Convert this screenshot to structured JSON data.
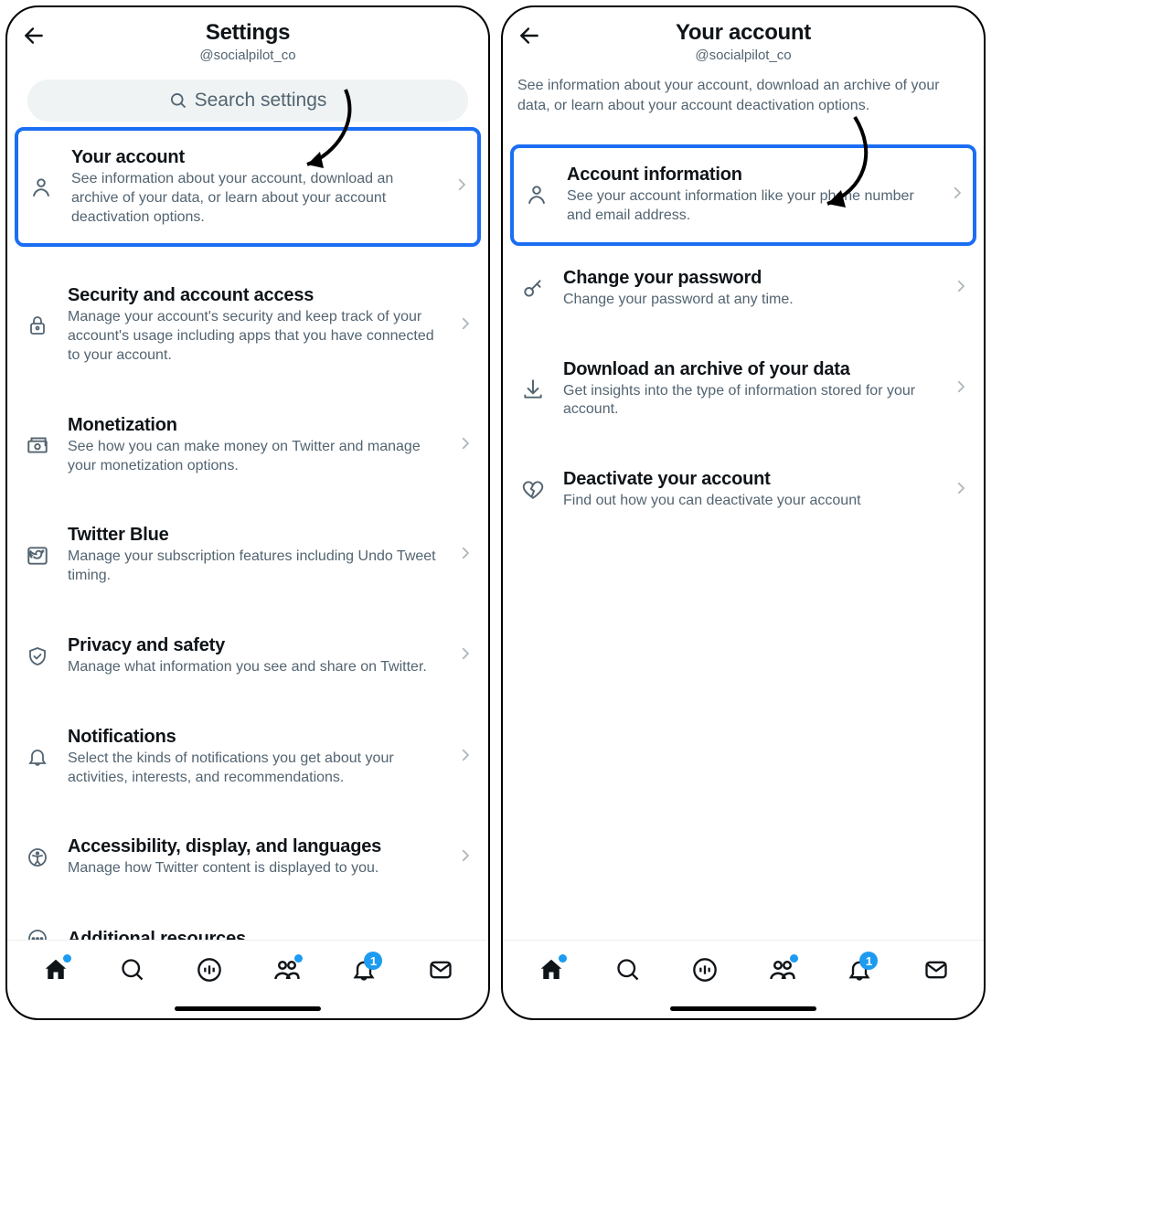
{
  "left": {
    "title": "Settings",
    "handle": "@socialpilot_co",
    "search_placeholder": "Search settings",
    "items": [
      {
        "label": "Your account",
        "desc": "See information about your account, download an archive of your data, or learn about your account deactivation options."
      },
      {
        "label": "Security and account access",
        "desc": "Manage your account's security and keep track of your account's usage including apps that you have connected to your account."
      },
      {
        "label": "Monetization",
        "desc": "See how you can make money on Twitter and manage your monetization options."
      },
      {
        "label": "Twitter Blue",
        "desc": "Manage your subscription features including Undo Tweet timing."
      },
      {
        "label": "Privacy and safety",
        "desc": "Manage what information you see and share on Twitter."
      },
      {
        "label": "Notifications",
        "desc": "Select the kinds of notifications you get about your activities, interests, and recommendations."
      },
      {
        "label": "Accessibility, display, and languages",
        "desc": "Manage how Twitter content is displayed to you."
      },
      {
        "label": "Additional resources",
        "desc": ""
      }
    ]
  },
  "right": {
    "title": "Your account",
    "handle": "@socialpilot_co",
    "subhead": "See information about your account, download an archive of your data, or learn about your account deactivation options.",
    "items": [
      {
        "label": "Account information",
        "desc": "See your account information like your phone number and email address."
      },
      {
        "label": "Change your password",
        "desc": "Change your password at any time."
      },
      {
        "label": "Download an archive of your data",
        "desc": "Get insights into the type of information stored for your account."
      },
      {
        "label": "Deactivate your account",
        "desc": "Find out how you can deactivate your account"
      }
    ]
  },
  "nav": {
    "notifications_count": "1"
  }
}
